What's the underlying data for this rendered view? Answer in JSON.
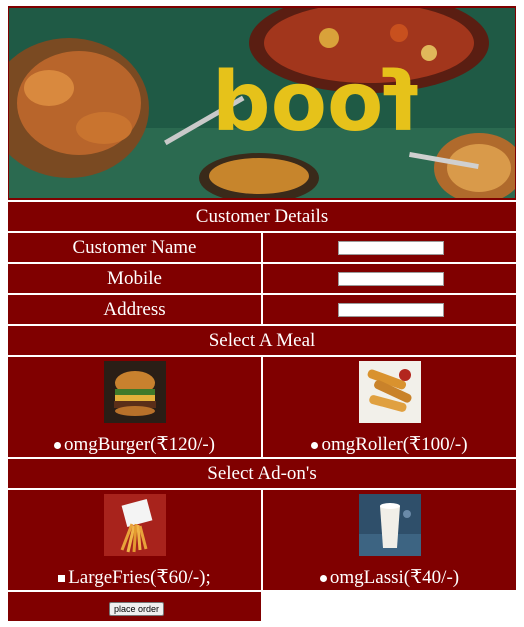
{
  "banner": {
    "logo_text": "food"
  },
  "customer": {
    "header": "Customer Details",
    "name_label": "Customer Name",
    "mobile_label": "Mobile",
    "address_label": "Address",
    "name_value": "",
    "mobile_value": "",
    "address_value": ""
  },
  "meal": {
    "header": "Select A Meal",
    "options": [
      {
        "label": "omgBurger(₹120/-)",
        "icon": "burger-image"
      },
      {
        "label": "omgRoller(₹100/-)",
        "icon": "spring-roll-image"
      }
    ]
  },
  "addons": {
    "header": "Select Ad-on's",
    "options": [
      {
        "label": "LargeFries(₹60/-);",
        "icon": "fries-image"
      },
      {
        "label": "omgLassi(₹40/-)",
        "icon": "lassi-image"
      }
    ]
  },
  "order_button": "place order",
  "colors": {
    "panel": "#800000",
    "text": "#ffffff",
    "banner_bg": "#1f5a45",
    "logo": "#e6c21a"
  }
}
